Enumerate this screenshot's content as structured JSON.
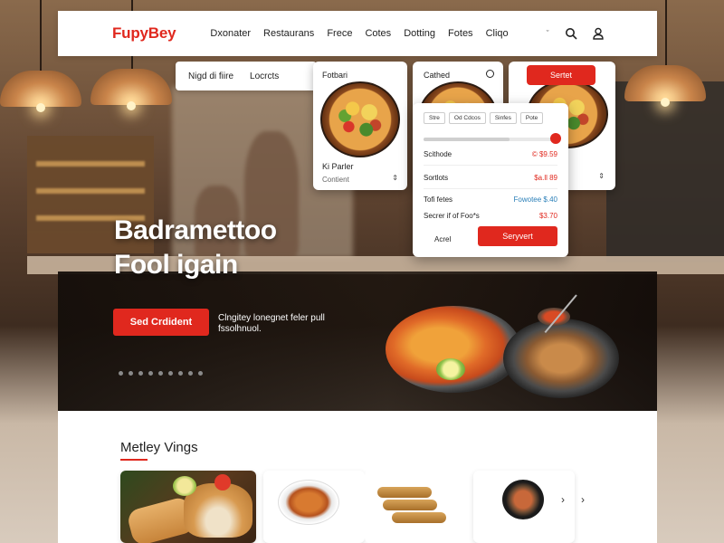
{
  "navbar": {
    "logo": "FupyBey",
    "links": [
      "Dxonater",
      "Restaurans",
      "Frece",
      "Cotes",
      "Dotting",
      "Fotes",
      "Cliqo"
    ],
    "caret": "ˇ"
  },
  "filter_bar": {
    "items": [
      "Nigd di fiire",
      "Locrcts"
    ]
  },
  "cards": [
    {
      "title": "Fotbari",
      "name": "Ki Parler",
      "meta": "Contient",
      "sort_icon": "sort-icon"
    },
    {
      "title": "Cathed",
      "close_icon": "close-icon"
    },
    {
      "button": "Sertet",
      "sort_icon": "sort-icon"
    }
  ],
  "popover": {
    "chips": [
      "Stre",
      "Od Cdcos",
      "Sinfes",
      "Pote"
    ],
    "slider_fraction": 0.64,
    "rows": [
      {
        "label": "Scithode",
        "value": "© $9.59",
        "highlight": "red"
      },
      {
        "label": "Sortlots",
        "value": "$a.ll 89",
        "highlight": "red"
      },
      {
        "label": "Tofi fetes",
        "value": "Fowotee $.40",
        "highlight": "blue"
      },
      {
        "label": "Secrer if of Foo*s",
        "value": "$3.70",
        "highlight": "red"
      }
    ],
    "cancel": "Acrel",
    "submit": "Seryvert"
  },
  "hero": {
    "title_line1": "Badramettoo",
    "title_line2": "Fool igain",
    "cta": "Sed Crdident",
    "subtitle": "Clngitey lonegnet feler pull fssolhnuol.",
    "dots_count": 9
  },
  "section": {
    "title": "Metley Vings",
    "arrow_left": "‹",
    "arrow_right": "›"
  },
  "colors": {
    "accent": "#e0281e",
    "blue_value": "#2a7fb8"
  }
}
